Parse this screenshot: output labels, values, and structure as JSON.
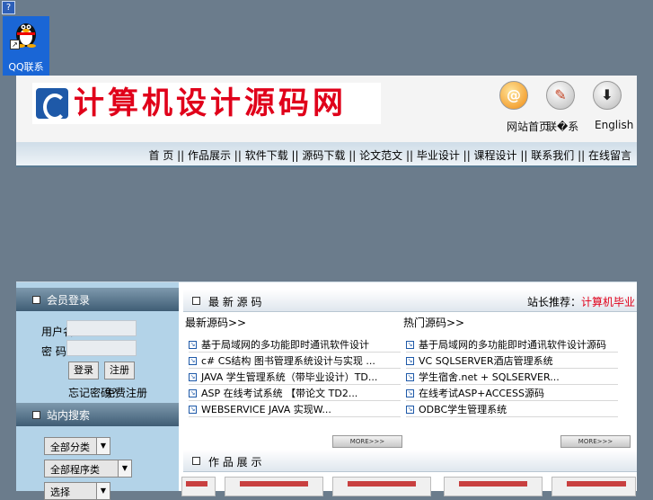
{
  "qq": {
    "label": "QQ联系",
    "help_glyph": "?"
  },
  "header": {
    "logo_text": "计算机设计源码网",
    "links": [
      "网站首页",
      "联�系",
      "English"
    ],
    "nav_items": "首 页 || 作品展示 || 软件下载 || 源码下载 || 论文范文 || 毕业设计 || 课程设计 || 联系我们 || 在线留言"
  },
  "sidebar": {
    "login_title": "会员登录",
    "username_label": "用户名：",
    "password_label": "密 码：",
    "login_btn": "登录",
    "register_btn": "注册",
    "forgot_text": "忘记密码？",
    "register_text": "免费注册",
    "search_title": "站内搜索",
    "select1": "全部分类",
    "select2": "全部程序类",
    "select3": "选择"
  },
  "content": {
    "panel1_title": "最 新 源 码",
    "panel1_right": "站长推荐：",
    "panel1_right_red": "计算机毕业",
    "left_col_title": "最新源码>>",
    "right_col_title": "热门源码>>",
    "left_items": [
      "基于局域网的多功能即时通讯软件设计",
      "c# CS结构 图书管理系统设计与实现 ...",
      "JAVA 学生管理系统（带毕业设计）TD...",
      "ASP 在线考试系统 【带论文 TD2...",
      "WEBSERVICE JAVA 实现W..."
    ],
    "right_items": [
      "基于局域网的多功能即时通讯软件设计源码",
      "VC SQLSERVER酒店管理系统",
      "学生宿舍.net + SQLSERVER...",
      "在线考试ASP+ACCESS源码",
      "ODBC学生管理系统"
    ],
    "more_label": "MORE>>>",
    "panel2_title": "作 品 展 示"
  },
  "colors": {
    "brand_red": "#e0001a",
    "brand_blue": "#1e59a8",
    "sidebar_bg": "#b3d3e8"
  }
}
